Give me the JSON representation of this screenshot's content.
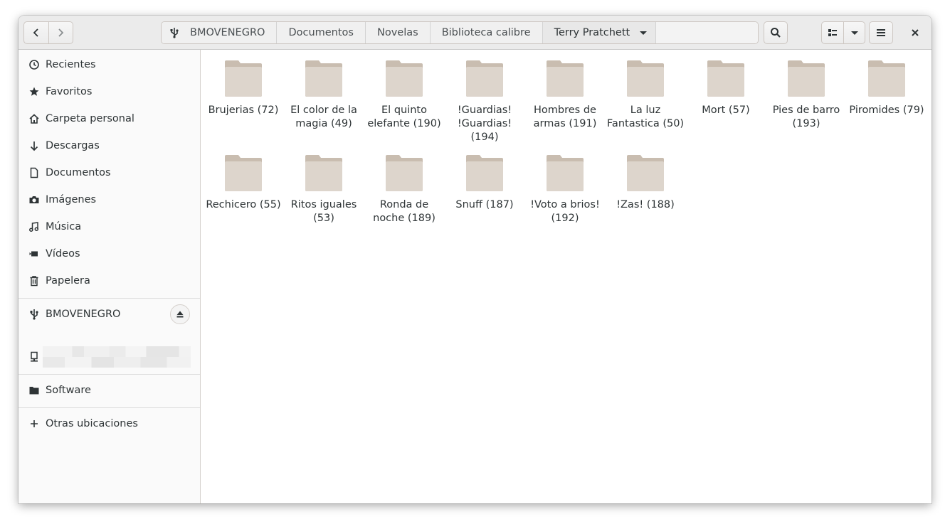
{
  "header": {
    "path": [
      "BMOVENEGRO",
      "Documentos",
      "Novelas",
      "Biblioteca calibre",
      "Terry Pratchett"
    ]
  },
  "sidebar": {
    "places": [
      {
        "label": "Recientes",
        "icon": "clock-icon"
      },
      {
        "label": "Favoritos",
        "icon": "star-icon"
      },
      {
        "label": "Carpeta personal",
        "icon": "home-icon"
      },
      {
        "label": "Descargas",
        "icon": "download-icon"
      },
      {
        "label": "Documentos",
        "icon": "document-icon"
      },
      {
        "label": "Imágenes",
        "icon": "camera-icon"
      },
      {
        "label": "Música",
        "icon": "music-icon"
      },
      {
        "label": "Vídeos",
        "icon": "video-icon"
      },
      {
        "label": "Papelera",
        "icon": "trash-icon"
      }
    ],
    "device": {
      "label": "BMOVENEGRO",
      "icon": "usb-icon"
    },
    "bookmark": {
      "label": "Software",
      "icon": "folder-icon"
    },
    "other": {
      "label": "Otras ubicaciones",
      "icon": "plus-icon"
    }
  },
  "folders": [
    "Brujerias (72)",
    "El color de la magia (49)",
    "El quinto elefante (190)",
    "!Guardias! !Guardias! (194)",
    "Hombres de armas (191)",
    "La luz Fantastica (50)",
    "Mort (57)",
    "Pies de barro (193)",
    "Piromides (79)",
    "Rechicero (55)",
    "Ritos iguales (53)",
    "Ronda de noche (189)",
    "Snuff (187)",
    "!Voto a brios! (192)",
    "!Zas! (188)"
  ],
  "colors": {
    "folder": "#ddd5cc",
    "folder_tab": "#c9bdb0"
  }
}
